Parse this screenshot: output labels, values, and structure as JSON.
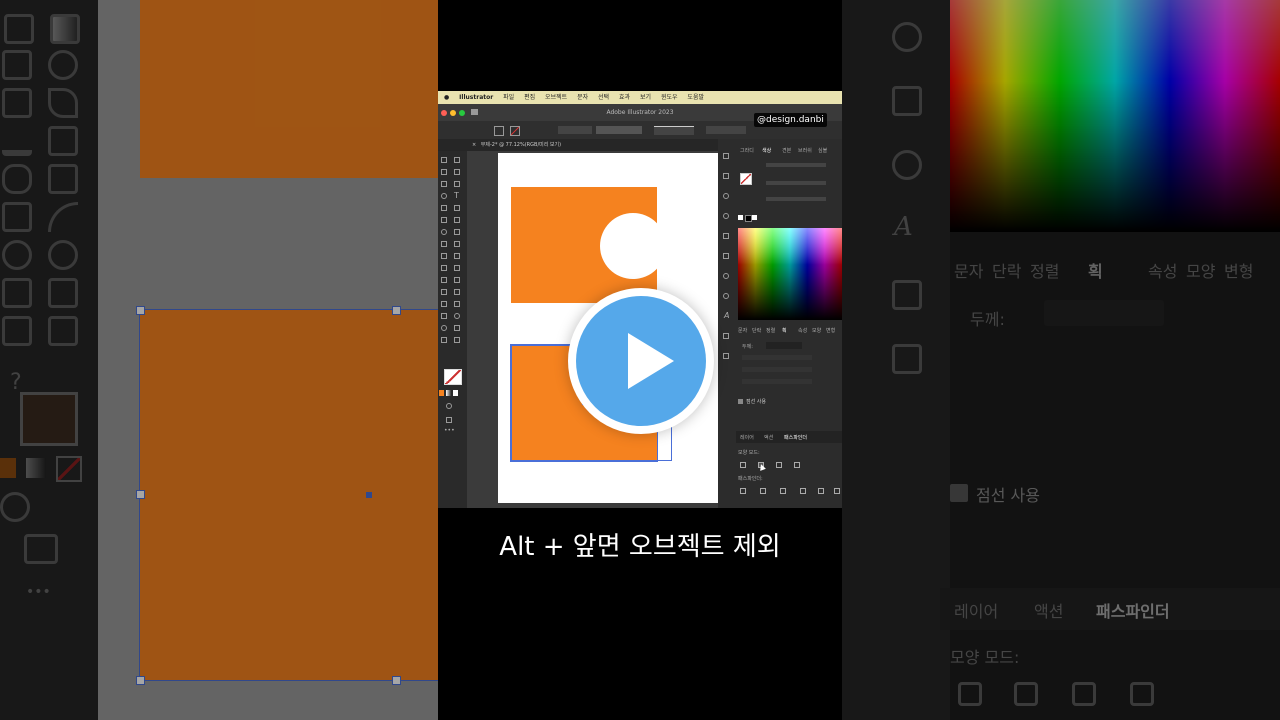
{
  "video": {
    "menubar": {
      "app_name": "Illustrator",
      "items": [
        "파일",
        "편집",
        "오브젝트",
        "문자",
        "선택",
        "효과",
        "보기",
        "윈도우",
        "도움말"
      ]
    },
    "window_title": "Adobe Illustrator 2023",
    "document_tab": "무제-2* @ 77.12%(RGB/미리 보기)",
    "watermark": "@design.danbi",
    "caption": "Alt + 앞면 오브젝트 제외",
    "panels": {
      "top_tabs": [
        "그라디",
        "색상",
        "견본",
        "브러쉬",
        "심볼"
      ],
      "char_tabs": [
        "문자",
        "단락",
        "정렬",
        "획",
        "속성",
        "모양",
        "변형"
      ],
      "stroke_label": "두께:",
      "dash_label": "점선 사용",
      "bottom_tabs": [
        "레이어",
        "액션",
        "패스파인더"
      ],
      "shape_modes_label": "모양 모드:",
      "pathfinder_label": "패스파인더:"
    },
    "colors": {
      "orange": "#f5821f",
      "yellow_circle": "#ecdd6a",
      "play_blue": "#55a8ea",
      "menubar": "#e9e3b0"
    }
  },
  "background_right": {
    "char_tabs": [
      "문자",
      "단락",
      "정렬",
      "획",
      "속성",
      "모양",
      "변형"
    ],
    "stroke_label": "두께:",
    "dash_label": "점선 사용",
    "bottom_tabs": [
      "레이어",
      "액션",
      "패스파인더"
    ],
    "shape_modes_label": "모양 모드:"
  },
  "background_left": {
    "help_glyph": "?",
    "more_glyph": "•••"
  }
}
